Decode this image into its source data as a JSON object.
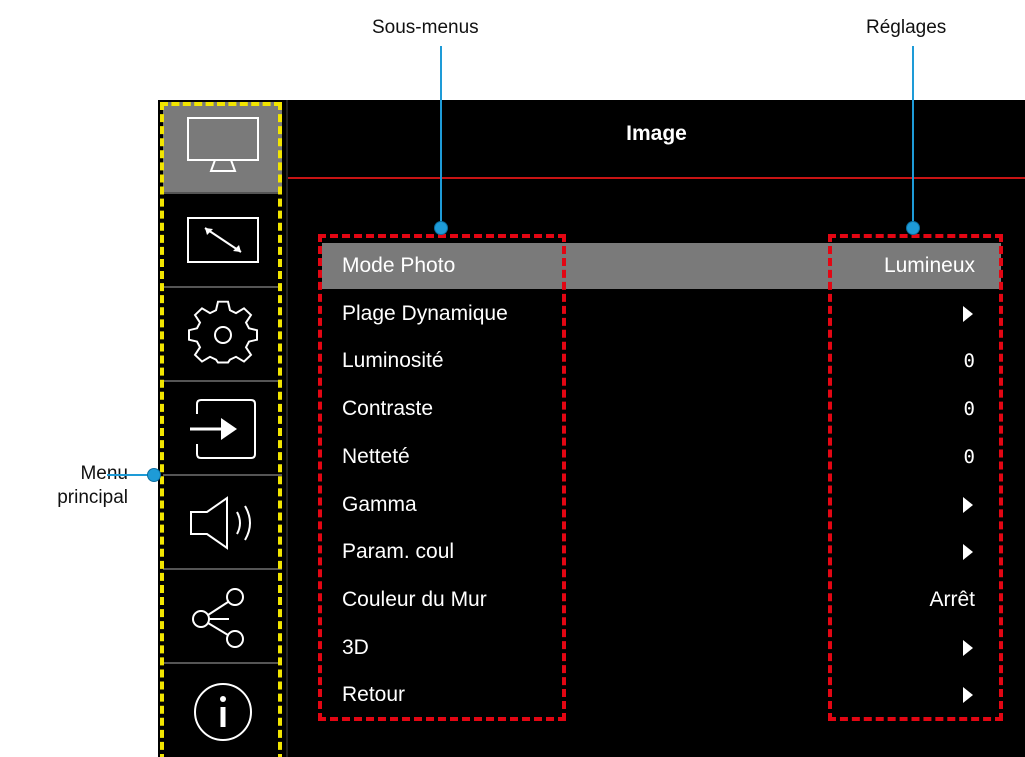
{
  "callouts": {
    "submenus": "Sous-menus",
    "settings": "Réglages",
    "main_menu_line1": "Menu",
    "main_menu_line2": "principal"
  },
  "panel": {
    "title": "Image"
  },
  "sidebar": {
    "items": [
      {
        "icon": "monitor-icon",
        "active": true
      },
      {
        "icon": "resize-icon",
        "active": false
      },
      {
        "icon": "gear-icon",
        "active": false
      },
      {
        "icon": "input-icon",
        "active": false
      },
      {
        "icon": "speaker-icon",
        "active": false
      },
      {
        "icon": "network-icon",
        "active": false
      },
      {
        "icon": "info-icon",
        "active": false
      }
    ]
  },
  "menu": {
    "rows": [
      {
        "label": "Mode Photo",
        "value": "Lumineux",
        "kind": "text",
        "selected": true
      },
      {
        "label": "Plage Dynamique",
        "value": "",
        "kind": "arrow",
        "selected": false
      },
      {
        "label": "Luminosité",
        "value": "0",
        "kind": "num",
        "selected": false
      },
      {
        "label": "Contraste",
        "value": "0",
        "kind": "num",
        "selected": false
      },
      {
        "label": "Netteté",
        "value": "0",
        "kind": "num",
        "selected": false
      },
      {
        "label": "Gamma",
        "value": "",
        "kind": "arrow",
        "selected": false
      },
      {
        "label": "Param. coul",
        "value": "",
        "kind": "arrow",
        "selected": false
      },
      {
        "label": "Couleur du Mur",
        "value": "Arrêt",
        "kind": "text",
        "selected": false
      },
      {
        "label": "3D",
        "value": "",
        "kind": "arrow",
        "selected": false
      },
      {
        "label": "Retour",
        "value": "",
        "kind": "arrow",
        "selected": false
      }
    ]
  },
  "colors": {
    "callout": "#1e9bd7",
    "main_menu_outline": "#f2e500",
    "highlight_outline": "#e30613",
    "selected_bg": "#7a7a7a",
    "title_rule": "#c81414"
  }
}
